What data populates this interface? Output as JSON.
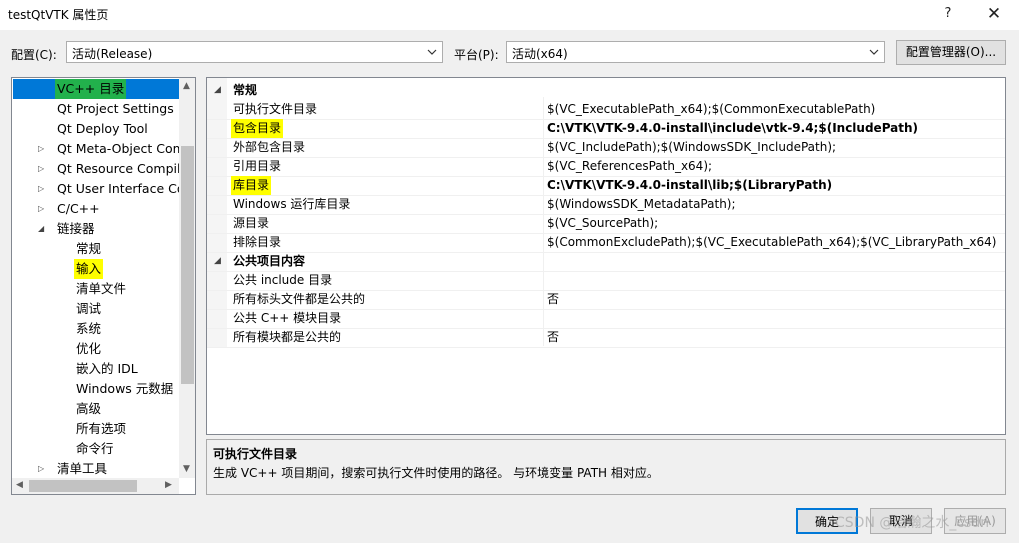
{
  "window": {
    "title": "testQtVTK 属性页",
    "help_glyph": "?",
    "close_glyph": "✕"
  },
  "config_bar": {
    "config_label": "配置(C):",
    "config_value": "活动(Release)",
    "platform_label": "平台(P):",
    "platform_value": "活动(x64)",
    "manager_button": "配置管理器(O)..."
  },
  "tree": {
    "items": [
      {
        "label": "VC++ 目录",
        "selected": true
      },
      {
        "label": "Qt Project Settings"
      },
      {
        "label": "Qt Deploy Tool"
      },
      {
        "label": "Qt Meta-Object Com"
      },
      {
        "label": "Qt Resource Compile"
      },
      {
        "label": "Qt User Interface Co"
      },
      {
        "label": "C/C++"
      },
      {
        "label": "链接器"
      },
      {
        "label": "常规"
      },
      {
        "label": "输入"
      },
      {
        "label": "清单文件"
      },
      {
        "label": "调试"
      },
      {
        "label": "系统"
      },
      {
        "label": "优化"
      },
      {
        "label": "嵌入的 IDL"
      },
      {
        "label": "Windows 元数据"
      },
      {
        "label": "高级"
      },
      {
        "label": "所有选项"
      },
      {
        "label": "命令行"
      },
      {
        "label": "清单工具"
      }
    ]
  },
  "grid": {
    "categories": [
      {
        "name": "常规",
        "rows": [
          {
            "name": "可执行文件目录",
            "value": "$(VC_ExecutablePath_x64);$(CommonExecutablePath)"
          },
          {
            "name": "包含目录",
            "value": "C:\\VTK\\VTK-9.4.0-install\\include\\vtk-9.4;$(IncludePath)"
          },
          {
            "name": "外部包含目录",
            "value": "$(VC_IncludePath);$(WindowsSDK_IncludePath);"
          },
          {
            "name": "引用目录",
            "value": "$(VC_ReferencesPath_x64);"
          },
          {
            "name": "库目录",
            "value": "C:\\VTK\\VTK-9.4.0-install\\lib;$(LibraryPath)"
          },
          {
            "name": "Windows 运行库目录",
            "value": "$(WindowsSDK_MetadataPath);"
          },
          {
            "name": "源目录",
            "value": "$(VC_SourcePath);"
          },
          {
            "name": "排除目录",
            "value": "$(CommonExcludePath);$(VC_ExecutablePath_x64);$(VC_LibraryPath_x64)"
          }
        ]
      },
      {
        "name": "公共项目内容",
        "rows": [
          {
            "name": "公共 include 目录",
            "value": ""
          },
          {
            "name": "所有标头文件都是公共的",
            "value": "否"
          },
          {
            "name": "公共 C++ 模块目录",
            "value": ""
          },
          {
            "name": "所有模块都是公共的",
            "value": "否"
          }
        ]
      }
    ]
  },
  "description": {
    "title": "可执行文件目录",
    "text": "生成 VC++ 项目期间，搜索可执行文件时使用的路径。 与环境变量 PATH 相对应。"
  },
  "footer": {
    "ok": "确定",
    "cancel": "取消",
    "apply": "应用(A)"
  },
  "watermark": "CSDN @治瀚之水_csdn",
  "colors": {
    "selection": "#0078d7",
    "highlight_green": "#22b14c",
    "highlight_yellow": "#ffff00"
  }
}
